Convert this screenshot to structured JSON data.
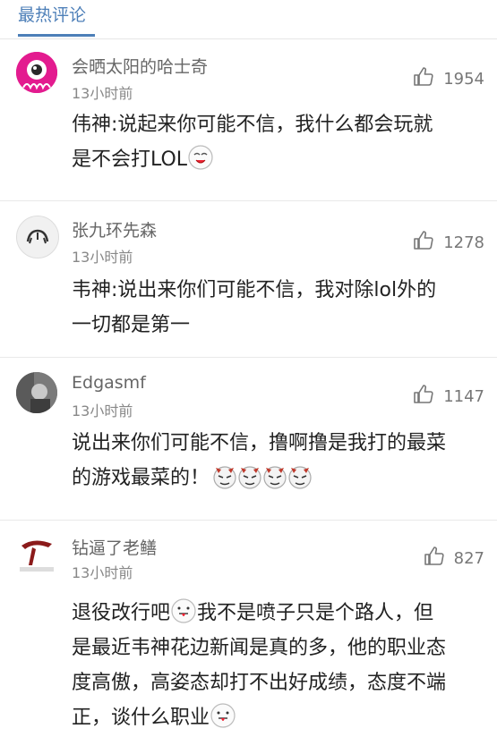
{
  "header": {
    "tab_title": "最热评论"
  },
  "comments": [
    {
      "username": "会晒太阳的哈士奇",
      "time": "13小时前",
      "likes": "1954",
      "text_a": "伟神:说起来你可能不信，我什么都会玩就",
      "text_b": "是不会打LOL",
      "avatar": "pink-octopus-avatar"
    },
    {
      "username": "张九环先森",
      "time": "13小时前",
      "likes": "1278",
      "text_a": "韦神:说出来你们可能不信，我对除lol外的",
      "text_b": "一切都是第一",
      "avatar": "sketch-avatar"
    },
    {
      "username": "Edgasmf",
      "time": "13小时前",
      "likes": "1147",
      "text_a": "说出来你们可能不信，撸啊撸是我打的最菜",
      "text_b": "的游戏最菜的！",
      "avatar": "photo-avatar"
    },
    {
      "username": "钻逼了老鳝",
      "time": "13小时前",
      "likes": "827",
      "text_a": "退役改行吧",
      "text_b": "我不是喷子只是个路人，但",
      "text_c": "是最近韦神花边新闻是真的多，他的职业态",
      "text_d": "度高傲，高姿态却打不出好成绩，态度不端",
      "text_e": "正，谈什么职业",
      "avatar": "logo-avatar"
    }
  ],
  "icons": {
    "like": "thumbs-up-icon",
    "emoji": "emoji-icon"
  },
  "colors": {
    "accent": "#4d7fb8",
    "text": "#222222",
    "meta": "#888888"
  }
}
